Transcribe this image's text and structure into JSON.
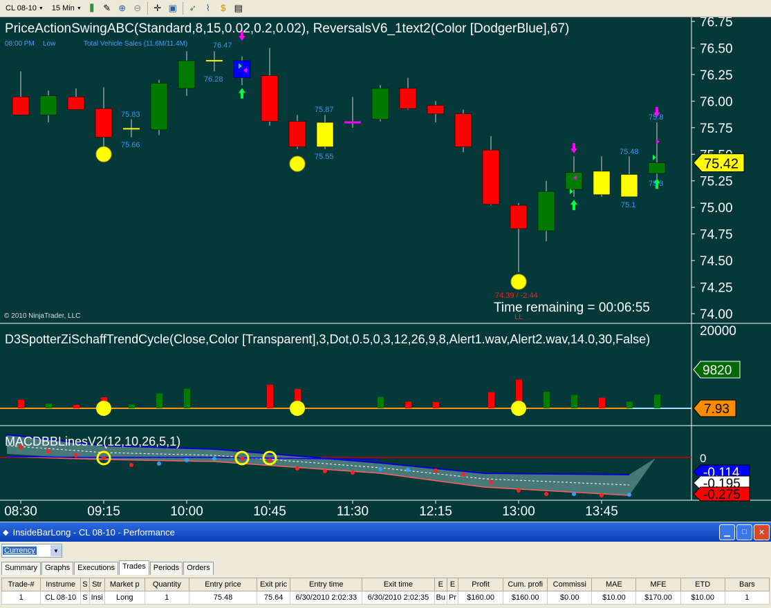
{
  "toolbar": {
    "instrument": "CL 08-10",
    "interval": "15 Min",
    "icons": [
      "bar-chart-icon",
      "pencil-icon",
      "zoom-in-icon",
      "zoom-out-icon",
      "crosshair-icon",
      "properties-icon",
      "strategy-icon",
      "indicator-icon",
      "dollar-icon",
      "data-box-icon"
    ]
  },
  "chart": {
    "price_title": "PriceActionSwingABC(Standard,8,15,0.02,0.2,0.02),  ReversalsV6_1text2(Color [DodgerBlue],67)",
    "info_time": "08:00 PM",
    "info_low": "Low",
    "info_news": "Total Vehicle Sales (11.6M/11.4M)",
    "copyright": "© 2010 NinjaTrader, LLC",
    "time_remaining": "Time remaining = 00:06:55",
    "last_price": "75.42",
    "price_axis": [
      "76.75",
      "76.50",
      "76.25",
      "76.00",
      "75.75",
      "75.50",
      "75.25",
      "75.00",
      "74.75",
      "74.50",
      "74.25",
      "74.00"
    ],
    "annotations": [
      "76.47",
      "76.28",
      "75.83",
      "75.66",
      "75.87",
      "75.55",
      "74.39 / -2.44",
      "75.48",
      "75.1",
      "75.8",
      "75.3",
      "LL"
    ],
    "stc_title": "D3SpotterZiSchaffTrendCycle(Close,Color  [Transparent],3,Dot,0.5,0,3,12,26,9,8,Alert1.wav,Alert2.wav,14.0,30,False)",
    "stc_axis_top": "20000",
    "stc_volume_label": "9820",
    "stc_value_label": "7.93",
    "macd_title": "MACDBBLinesV2(12,10,26,5,1)",
    "macd_zero": "0",
    "macd_labels": [
      "-0.114",
      "-0.195",
      "-0.275"
    ],
    "time_axis": [
      "08:30",
      "09:15",
      "10:00",
      "10:45",
      "11:30",
      "12:15",
      "13:00",
      "13:45"
    ]
  },
  "chart_data": {
    "type": "candlestick",
    "x": [
      "08:30",
      "08:45",
      "09:00",
      "09:15",
      "09:30",
      "09:45",
      "10:00",
      "10:15",
      "10:30",
      "10:45",
      "11:00",
      "11:15",
      "11:30",
      "11:45",
      "12:00",
      "12:15",
      "12:30",
      "12:45",
      "13:00",
      "13:15",
      "13:30",
      "13:45",
      "14:00",
      "14:15"
    ],
    "candles": [
      {
        "open": 76.04,
        "high": 76.28,
        "low": 75.9,
        "close": 75.87,
        "color": "red"
      },
      {
        "open": 75.87,
        "high": 76.1,
        "low": 75.8,
        "close": 76.05,
        "color": "green"
      },
      {
        "open": 76.04,
        "high": 76.12,
        "low": 75.95,
        "close": 75.92,
        "color": "red"
      },
      {
        "open": 75.93,
        "high": 76.13,
        "low": 75.53,
        "close": 75.66,
        "color": "red"
      },
      {
        "open": 75.74,
        "high": 75.83,
        "low": 75.66,
        "close": 75.74,
        "color": "yellow"
      },
      {
        "open": 75.73,
        "high": 76.2,
        "low": 75.68,
        "close": 76.17,
        "color": "green"
      },
      {
        "open": 76.12,
        "high": 76.47,
        "low": 76.05,
        "close": 76.38,
        "color": "green"
      },
      {
        "open": 76.38,
        "high": 76.47,
        "low": 76.28,
        "close": 76.38,
        "color": "yellow"
      },
      {
        "open": 76.22,
        "high": 76.42,
        "low": 76.15,
        "close": 76.38,
        "color": "blue"
      },
      {
        "open": 76.24,
        "high": 76.5,
        "low": 75.77,
        "close": 75.81,
        "color": "red"
      },
      {
        "open": 75.81,
        "high": 75.87,
        "low": 75.55,
        "close": 75.57,
        "color": "red"
      },
      {
        "open": 75.57,
        "high": 75.87,
        "low": 75.55,
        "close": 75.8,
        "color": "yellow"
      },
      {
        "open": 75.8,
        "high": 76.04,
        "low": 75.75,
        "close": 75.8,
        "color": "magenta"
      },
      {
        "open": 75.83,
        "high": 76.15,
        "low": 75.81,
        "close": 76.12,
        "color": "green"
      },
      {
        "open": 76.12,
        "high": 76.22,
        "low": 75.92,
        "close": 75.93,
        "color": "red"
      },
      {
        "open": 75.96,
        "high": 76.0,
        "low": 75.8,
        "close": 75.88,
        "color": "red"
      },
      {
        "open": 75.88,
        "high": 75.92,
        "low": 75.52,
        "close": 75.57,
        "color": "red"
      },
      {
        "open": 75.54,
        "high": 75.67,
        "low": 75.02,
        "close": 75.03,
        "color": "red"
      },
      {
        "open": 75.02,
        "high": 75.04,
        "low": 74.39,
        "close": 74.8,
        "color": "red"
      },
      {
        "open": 74.78,
        "high": 75.25,
        "low": 74.68,
        "close": 75.15,
        "color": "green"
      },
      {
        "open": 75.17,
        "high": 75.48,
        "low": 75.1,
        "close": 75.33,
        "color": "green"
      },
      {
        "open": 75.34,
        "high": 75.48,
        "low": 75.1,
        "close": 75.12,
        "color": "yellow"
      },
      {
        "open": 75.31,
        "high": 75.48,
        "low": 75.1,
        "close": 75.1,
        "color": "yellow"
      },
      {
        "open": 75.32,
        "high": 75.8,
        "low": 75.25,
        "close": 75.42,
        "color": "green"
      }
    ],
    "ylim": [
      74.0,
      76.75
    ],
    "volume": [
      2200,
      1200,
      900,
      2800,
      1000,
      3800,
      5000,
      0,
      0,
      6000,
      4900,
      0,
      0,
      2900,
      1700,
      1600,
      0,
      4100,
      7300,
      4200,
      3400,
      2700,
      1700,
      3500
    ],
    "volume_colors": [
      "red",
      "green",
      "red",
      "red",
      "green",
      "green",
      "green",
      "none",
      "none",
      "red",
      "red",
      "none",
      "none",
      "green",
      "red",
      "red",
      "none",
      "red",
      "red",
      "green",
      "green",
      "red",
      "green",
      "green"
    ]
  }
}
